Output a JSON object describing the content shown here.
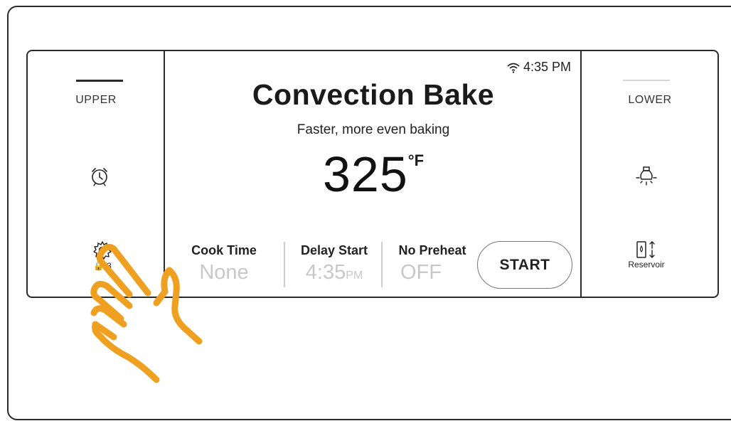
{
  "upper": {
    "label": "UPPER"
  },
  "lower": {
    "label": "LOWER"
  },
  "left_icons": {
    "timer_icon": "alarm-clock-icon",
    "settings_icon": "gear-icon",
    "settings_lock_text": "🔒(3"
  },
  "right_icons": {
    "light_icon": "light-bulb-icon",
    "reservoir_icon": "reservoir-icon",
    "reservoir_label": "Reservoir"
  },
  "status": {
    "wifi_icon": "wifi-icon",
    "time": "4:35 PM"
  },
  "mode": {
    "title": "Convection Bake",
    "subtitle": "Faster, more even baking"
  },
  "temperature": {
    "value": "325",
    "unit": "°F"
  },
  "settings": {
    "cook_time": {
      "label": "Cook Time",
      "value": "None"
    },
    "delay_start": {
      "label": "Delay Start",
      "value": "4:35",
      "value_suffix": "PM"
    },
    "no_preheat": {
      "label": "No Preheat",
      "value": "OFF"
    }
  },
  "start_button": {
    "label": "START"
  },
  "colors": {
    "outline": "#2a2a2a",
    "inactive_value": "#c8c8c8",
    "hand": "#f0a020"
  }
}
